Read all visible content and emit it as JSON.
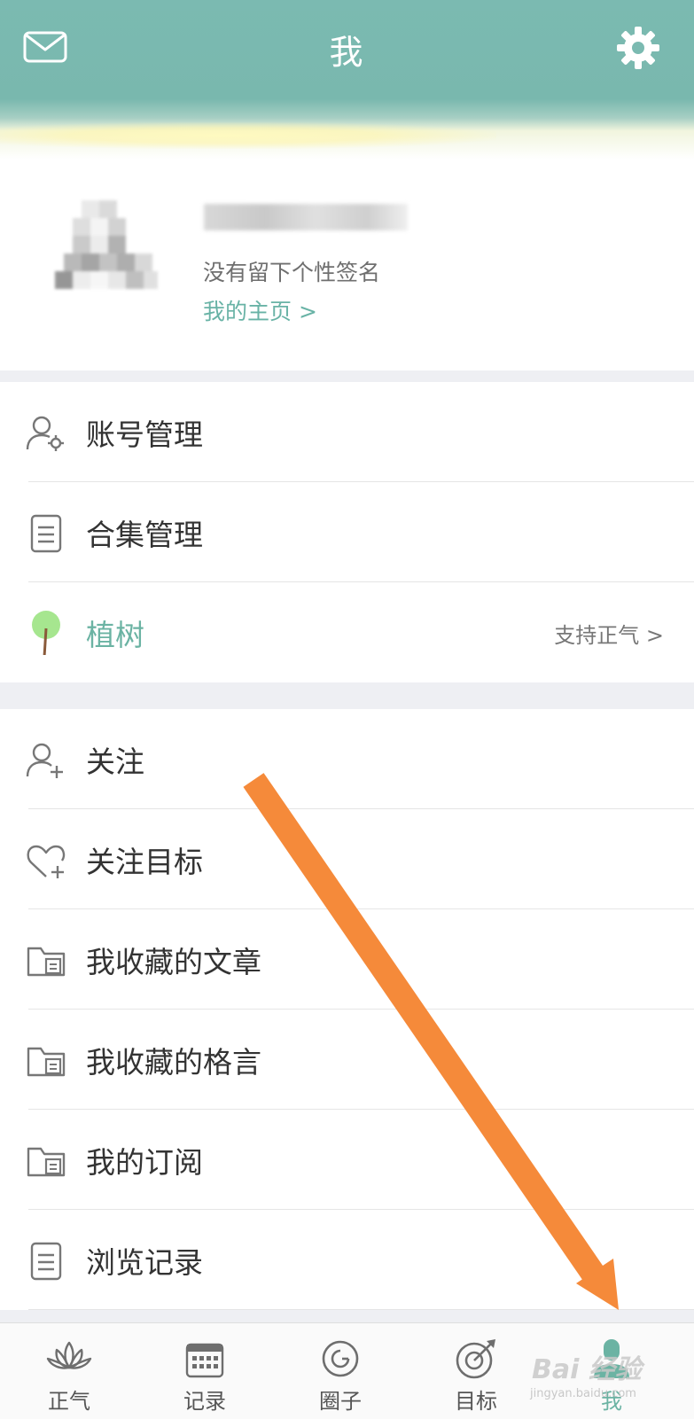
{
  "header": {
    "title": "我",
    "left_icon": "mail-icon",
    "right_icon": "gear-icon",
    "bg_color": "#7bbab1"
  },
  "profile": {
    "signature": "没有留下个性签名",
    "homepage_link": "我的主页 >"
  },
  "menu_group_1": [
    {
      "icon": "user-gear-icon",
      "label": "账号管理"
    },
    {
      "icon": "document-icon",
      "label": "合集管理"
    },
    {
      "icon": "tree-icon",
      "label": "植树",
      "right_text": "支持正气 >"
    }
  ],
  "menu_group_2": [
    {
      "icon": "user-plus-icon",
      "label": "关注"
    },
    {
      "icon": "heart-plus-icon",
      "label": "关注目标"
    },
    {
      "icon": "folder-doc-icon",
      "label": "我收藏的文章"
    },
    {
      "icon": "folder-doc-icon",
      "label": "我收藏的格言"
    },
    {
      "icon": "folder-doc-icon",
      "label": "我的订阅"
    },
    {
      "icon": "document-icon",
      "label": "浏览记录"
    }
  ],
  "tabbar": {
    "tabs": [
      {
        "icon": "lotus-icon",
        "label": "正气"
      },
      {
        "icon": "calendar-icon",
        "label": "记录"
      },
      {
        "icon": "circle-icon",
        "label": "圈子"
      },
      {
        "icon": "target-icon",
        "label": "目标"
      },
      {
        "icon": "person-icon",
        "label": "我",
        "active": true
      }
    ],
    "active_color": "#6bb3a3"
  },
  "annotation": {
    "arrow_color": "#f58a3a"
  },
  "watermark": {
    "text": "Bai 经验",
    "sub": "jingyan.baidu.com"
  }
}
